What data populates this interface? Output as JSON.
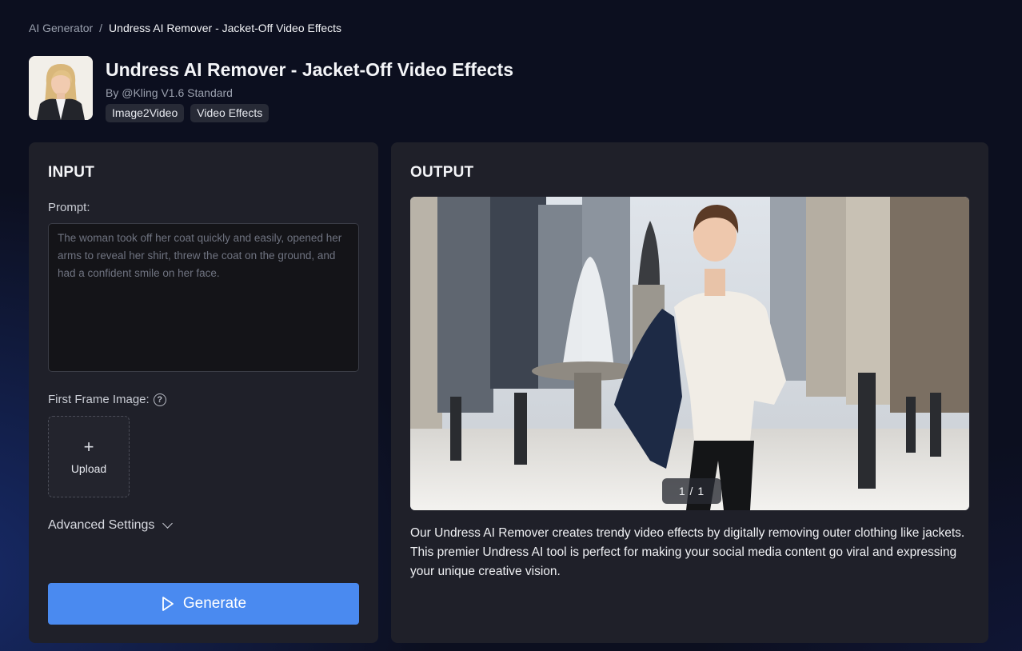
{
  "breadcrumb": {
    "parent": "AI Generator",
    "separator": "/",
    "current": "Undress AI Remover - Jacket-Off Video Effects"
  },
  "header": {
    "title": "Undress AI Remover - Jacket-Off Video Effects",
    "author": "By @Kling V1.6 Standard",
    "tags": [
      "Image2Video",
      "Video Effects"
    ]
  },
  "input": {
    "heading": "INPUT",
    "prompt_label": "Prompt:",
    "prompt_placeholder": "The woman took off her coat quickly and easily, opened her arms to reveal her shirt, threw the coat on the ground, and had a confident smile on her face.",
    "first_frame_label": "First Frame Image:",
    "help_icon_glyph": "?",
    "upload_plus": "+",
    "upload_label": "Upload",
    "advanced_label": "Advanced Settings",
    "generate_label": "Generate"
  },
  "output": {
    "heading": "OUTPUT",
    "counter": "1 / 1",
    "description": "Our Undress AI Remover creates trendy video effects by digitally removing outer clothing like jackets. This premier Undress AI tool is perfect for making your social media content go viral and expressing your unique creative vision."
  },
  "icons": {
    "help": "help-icon",
    "chevron": "chevron-down-icon",
    "play": "play-icon",
    "plus": "plus-icon"
  },
  "colors": {
    "accent": "#4a8af0",
    "panel": "#1f2029",
    "background": "#0c0f1f"
  }
}
